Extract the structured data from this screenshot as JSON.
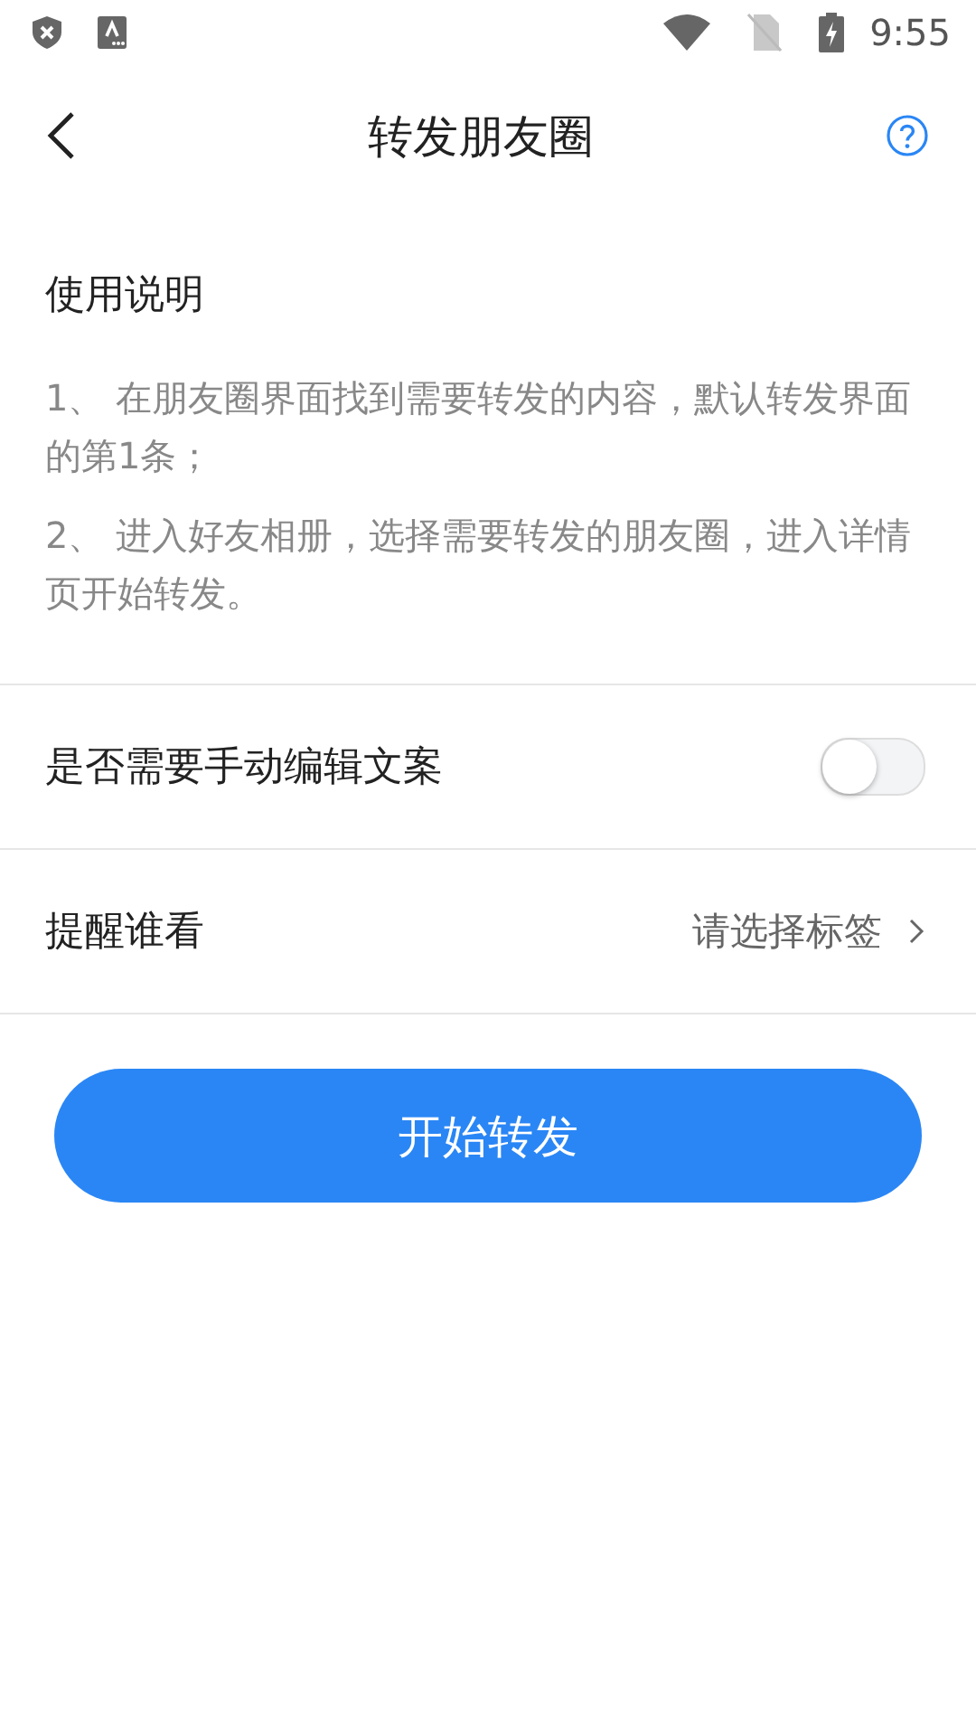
{
  "status_bar": {
    "time": "9:55"
  },
  "header": {
    "title": "转发朋友圈"
  },
  "instructions": {
    "title": "使用说明",
    "steps": [
      "1、 在朋友圈界面找到需要转发的内容，默认转发界面的第1条；",
      "2、 进入好友相册，选择需要转发的朋友圈，进入详情页开始转发。"
    ]
  },
  "settings": [
    {
      "kind": "toggle",
      "label": "是否需要手动编辑文案",
      "on": false
    },
    {
      "kind": "select",
      "label": "提醒谁看",
      "value": "请选择标签"
    }
  ],
  "primary_button": "开始转发"
}
